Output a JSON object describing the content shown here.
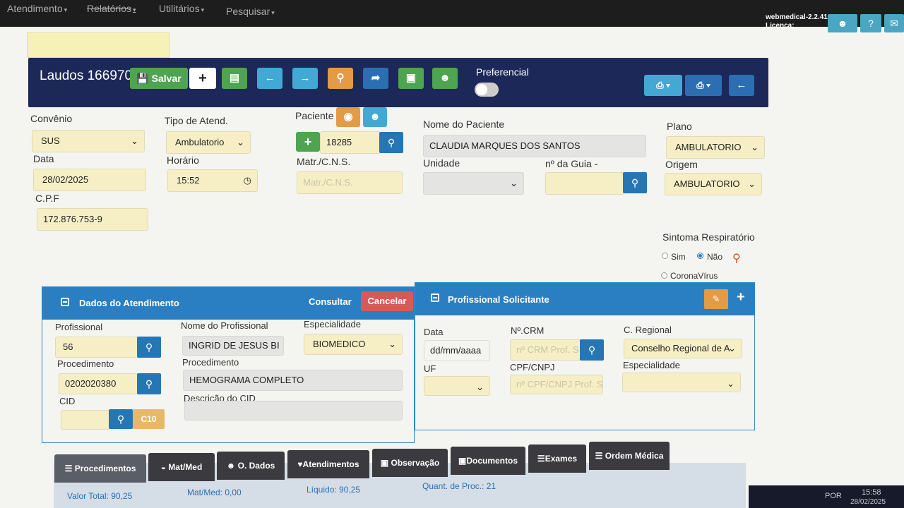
{
  "nav": {
    "menus": [
      "Atendimento",
      "Relatórios",
      "Utilitários",
      "Pesquisar"
    ],
    "version": "webmedical-2.2.41",
    "license": "Licença:",
    "icons": [
      "user-icon",
      "help-icon",
      "mail-icon"
    ]
  },
  "toolbar": {
    "title": "Laudos 166970",
    "save_label": "Salvar",
    "preferencial_label": "Preferencial"
  },
  "form": {
    "convenio_label": "Convênio",
    "convenio_value": "SUS",
    "tipo_label": "Tipo de Atend.",
    "tipo_value": "Ambulatorio",
    "paciente_label": "Paciente",
    "paciente_value": "18285",
    "nome_label": "Nome do Paciente",
    "nome_value": "CLAUDIA MARQUES DOS SANTOS",
    "plano_label": "Plano",
    "plano_value": "AMBULATORIO",
    "data_label": "Data",
    "data_value": "28/02/2025",
    "horario_label": "Horário",
    "horario_value": "15:52",
    "matr_label": "Matr./C.N.S.",
    "matr_placeholder": "Matr./C.N.S.",
    "unidade_label": "Unidade",
    "guia_label": "nº da Guia -",
    "origem_label": "Origem",
    "origem_value": "AMBULATORIO",
    "cpf_label": "C.P.F",
    "cpf_value": "172.876.753-9",
    "sintoma_label": "Sintoma Respiratório",
    "sim_label": "Sim",
    "nao_label": "Não",
    "corona_label": "CoronaVírus"
  },
  "atendimento": {
    "title": "Dados do Atendimento",
    "consultar": "Consultar",
    "cancelar": "Cancelar",
    "profissional_label": "Profissional",
    "profissional_value": "56",
    "nome_prof_label": "Nome do Profissional",
    "nome_prof_value": "INGRID DE JESUS BI",
    "especialidade_label": "Especialidade",
    "especialidade_value": "BIOMEDICO",
    "procedimento_label": "Procedimento",
    "procedimento_value": "0202020380",
    "procedimento_nome_label": "Procedimento",
    "procedimento_nome_value": "HEMOGRAMA COMPLETO",
    "cid_label": "CID",
    "cid_button": "C10",
    "descricao_cid_label": "Descrição do CID"
  },
  "solicitante": {
    "title": "Profissional Solicitante",
    "data_label": "Data",
    "data_value": "dd/mm/aaaa",
    "crm_label": "Nº.CRM",
    "crm_placeholder": "nº CRM Prof. S",
    "regional_label": "C. Regional",
    "regional_value": "Conselho Regional de A",
    "uf_label": "UF",
    "cpf_label": "CPF/CNPJ",
    "cpf_placeholder": "nº CPF/CNPJ Prof. Sc",
    "especialidade_label": "Especialidade"
  },
  "tabs": [
    "Procedimentos",
    "Mat/Med",
    "O. Dados",
    "Atendimentos",
    "Observação",
    "Documentos",
    "Exames",
    "Ordem Médica"
  ],
  "totals": {
    "valor_total": "Valor Total: 90,25",
    "matmed": "Mat/Med: 0,00",
    "liquido": "Líquido: 90,25",
    "quant": "Quant. de Proc.: 21"
  },
  "taskbar": {
    "lang": "POR",
    "time": "15:58",
    "date": "28/02/2025"
  }
}
